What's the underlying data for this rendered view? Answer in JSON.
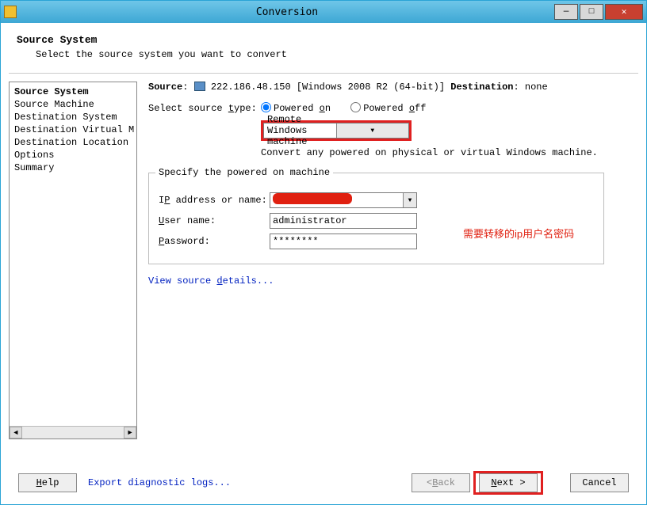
{
  "window": {
    "title": "Conversion",
    "min_glyph": "—",
    "max_glyph": "□",
    "close_glyph": "✕"
  },
  "header": {
    "title": "Source System",
    "subtitle": "Select the source system you want to convert"
  },
  "nav": {
    "items": [
      {
        "label": "Source System",
        "bold": true
      },
      {
        "label": "Source Machine"
      },
      {
        "label": "Destination System"
      },
      {
        "label": "Destination Virtual M"
      },
      {
        "label": "Destination Location"
      },
      {
        "label": "Options"
      },
      {
        "label": "Summary"
      }
    ]
  },
  "main": {
    "source_label": "Source",
    "source_value": "222.186.48.150 [Windows 2008 R2 (64-bit)]",
    "dest_label": "Destination",
    "dest_value": "none",
    "select_type_label": "Select source type:",
    "select_type_t_char": "t",
    "radio_on": "Powered on",
    "radio_on_char": "o",
    "radio_off": "Powered off",
    "radio_off_char": "o",
    "combo_value": "Remote Windows machine",
    "hint": "Convert any powered on physical or virtual Windows machine.",
    "group_legend": "Specify the powered on machine",
    "ip_label_pre": "I",
    "ip_label_char": "P",
    "ip_label_post": " address or name:",
    "user_label_char": "U",
    "user_label_post": "ser name:",
    "user_value": "administrator",
    "pass_label_char": "P",
    "pass_label_post": "assword:",
    "pass_value": "********",
    "details_pre": "View source ",
    "details_char": "d",
    "details_post": "etails..."
  },
  "annot": "需要转移的ip用户名密码",
  "footer": {
    "help_char": "H",
    "help_post": "elp",
    "diag": "Export diagnostic logs...",
    "back_pre": "< ",
    "back_char": "B",
    "back_post": "ack",
    "next_char": "N",
    "next_post": "ext >",
    "cancel": "Cancel"
  }
}
